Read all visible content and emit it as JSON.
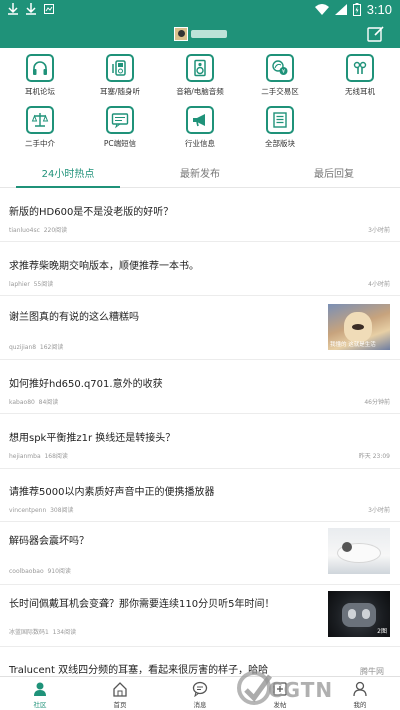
{
  "status_bar": {
    "time": "3:10"
  },
  "categories": [
    {
      "label": "耳机论坛",
      "icon": "headphones-icon"
    },
    {
      "label": "耳塞/随身听",
      "icon": "portable-player-icon"
    },
    {
      "label": "音箱/电脑音频",
      "icon": "speaker-icon"
    },
    {
      "label": "二手交易区",
      "icon": "trade-icon"
    },
    {
      "label": "无线耳机",
      "icon": "wireless-earbuds-icon"
    },
    {
      "label": "二手中介",
      "icon": "scale-icon"
    },
    {
      "label": "PC端短信",
      "icon": "pc-message-icon"
    },
    {
      "label": "行业信息",
      "icon": "megaphone-icon"
    },
    {
      "label": "全部版块",
      "icon": "all-sections-icon"
    }
  ],
  "tabs": [
    {
      "label": "24小时热点"
    },
    {
      "label": "最新发布"
    },
    {
      "label": "最后回复"
    }
  ],
  "posts": [
    {
      "title": "新版的HD600是不是没老版的好听？",
      "author": "tianluo4sc",
      "reads": "220阅读",
      "time": "3小时前"
    },
    {
      "title": "求推荐柴晚期交响版本，顺便推荐一本书。",
      "author": "laphier",
      "reads": "55阅读",
      "time": "4小时前"
    },
    {
      "title": "谢兰图真的有说的这么糟糕吗",
      "author": "quzijian8",
      "reads": "162阅读",
      "time": "",
      "thumb_caption": "我懂的 这就是生活"
    },
    {
      "title": "如何推好hd650.q701.意外的收获",
      "author": "kabao80",
      "reads": "84阅读",
      "time": "46分钟前"
    },
    {
      "title": "想用spk平衡推z1r 换线还是转接头？",
      "author": "hejianmba",
      "reads": "168阅读",
      "time": "昨天 23:09"
    },
    {
      "title": "请推荐5000以内素质好声音中正的便携播放器",
      "author": "vincentpenn",
      "reads": "308阅读",
      "time": "3小时前"
    },
    {
      "title": "解码器会震坏吗？",
      "author": "coolbaobao",
      "reads": "910阅读",
      "time": ""
    },
    {
      "title": "长时间佩戴耳机会变聋？那你需要连续110分贝听5年时间！",
      "author": "冰蓝国际数码1",
      "reads": "134阅读",
      "time": "",
      "thumb_badge": "2图"
    },
    {
      "title": "Tralucent 双线四分频的耳塞，看起来很厉害的样子，哈哈",
      "author": "",
      "reads": "",
      "time": ""
    }
  ],
  "bottom_nav": [
    {
      "label": "社区"
    },
    {
      "label": "首页"
    },
    {
      "label": "消息"
    },
    {
      "label": "发帖"
    },
    {
      "label": "我的"
    }
  ],
  "watermark": {
    "main": "CGTN",
    "small": "腾牛网"
  },
  "colors": {
    "brand": "#1f9279",
    "text": "#222222",
    "muted": "#999999"
  }
}
